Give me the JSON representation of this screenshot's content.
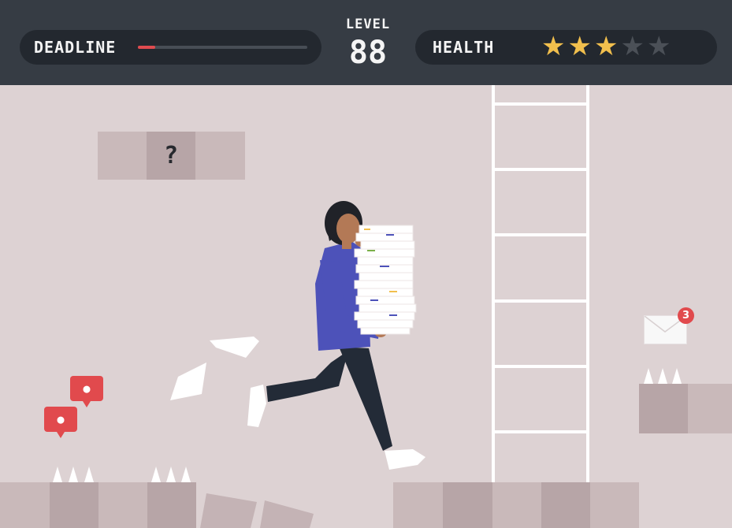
{
  "hud": {
    "deadline_label": "DEADLINE",
    "deadline_progress": 0.1,
    "level_label": "LEVEL",
    "level_value": "88",
    "health_label": "HEALTH",
    "health_rating": 3,
    "health_max": 5
  },
  "mystery_block": {
    "symbol": "?"
  },
  "notifications": {
    "unread_count": "3"
  },
  "colors": {
    "hud_bg": "#363c44",
    "hud_pill": "#23282f",
    "deadline_bar": "#e04b4f",
    "star_on": "#f1bf4d",
    "star_off": "#4b5057",
    "background": "#ddd2d3",
    "alert": "#e14a4d",
    "shirt": "#4d52b9",
    "pants": "#232b37"
  },
  "icons": [
    "star-icon",
    "question-block-icon",
    "envelope-icon",
    "chat-bubble-icon",
    "ladder-icon",
    "spike-icon"
  ]
}
